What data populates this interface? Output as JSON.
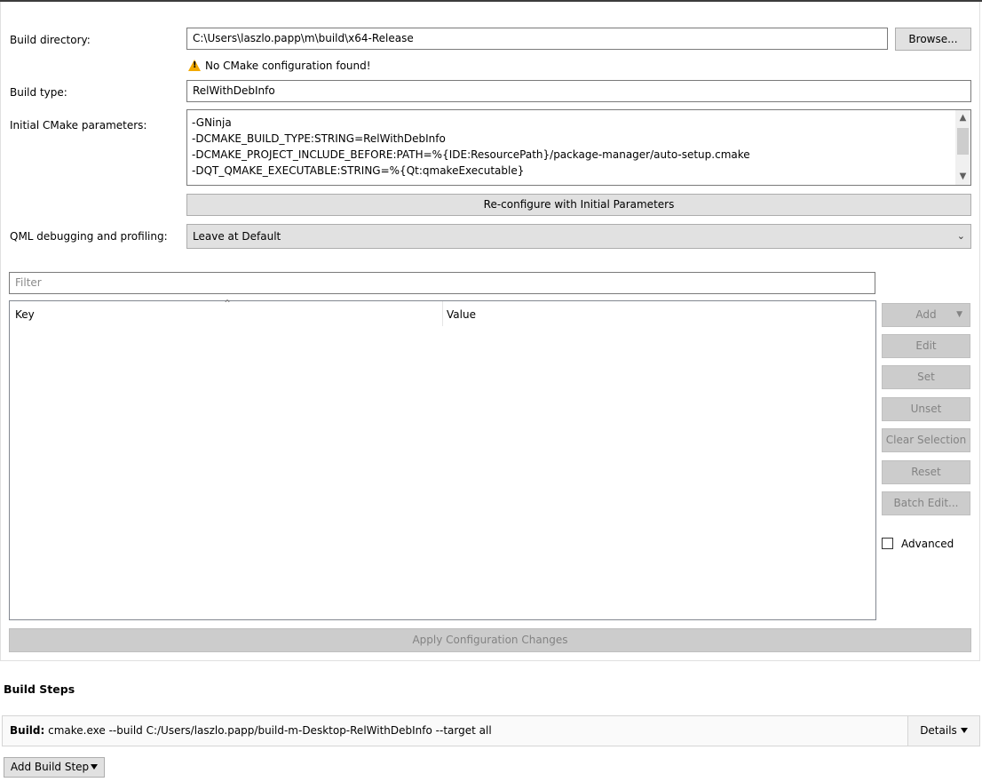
{
  "build_directory": {
    "label": "Build directory:",
    "value": "C:\\Users\\laszlo.papp\\m\\build\\x64-Release",
    "browse_label": "Browse...",
    "warning": "No CMake configuration found!"
  },
  "build_type": {
    "label": "Build type:",
    "value": "RelWithDebInfo"
  },
  "initial_params": {
    "label": "Initial CMake parameters:",
    "lines": [
      "-GNinja",
      "-DCMAKE_BUILD_TYPE:STRING=RelWithDebInfo",
      "-DCMAKE_PROJECT_INCLUDE_BEFORE:PATH=%{IDE:ResourcePath}/package-manager/auto-setup.cmake",
      "-DQT_QMAKE_EXECUTABLE:STRING=%{Qt:qmakeExecutable}"
    ],
    "reconfigure_label": "Re-configure with Initial Parameters"
  },
  "qml": {
    "label": "QML debugging and profiling:",
    "value": "Leave at Default"
  },
  "filter": {
    "placeholder": "Filter"
  },
  "table": {
    "columns": [
      "Key",
      "Value"
    ],
    "rows": []
  },
  "side_buttons": {
    "add": "Add",
    "edit": "Edit",
    "set": "Set",
    "unset": "Unset",
    "clear_selection": "Clear Selection",
    "reset": "Reset",
    "batch_edit": "Batch Edit...",
    "advanced": "Advanced"
  },
  "apply_label": "Apply Configuration Changes",
  "build_steps": {
    "heading": "Build Steps",
    "step_prefix": "Build:",
    "step_command": "cmake.exe --build C:/Users/laszlo.papp/build-m-Desktop-RelWithDebInfo --target all",
    "details_label": "Details",
    "add_step_label": "Add Build Step"
  },
  "colors": {
    "warning": "#f2a900",
    "disabled_text": "#838383",
    "button_bg": "#e1e1e1"
  }
}
